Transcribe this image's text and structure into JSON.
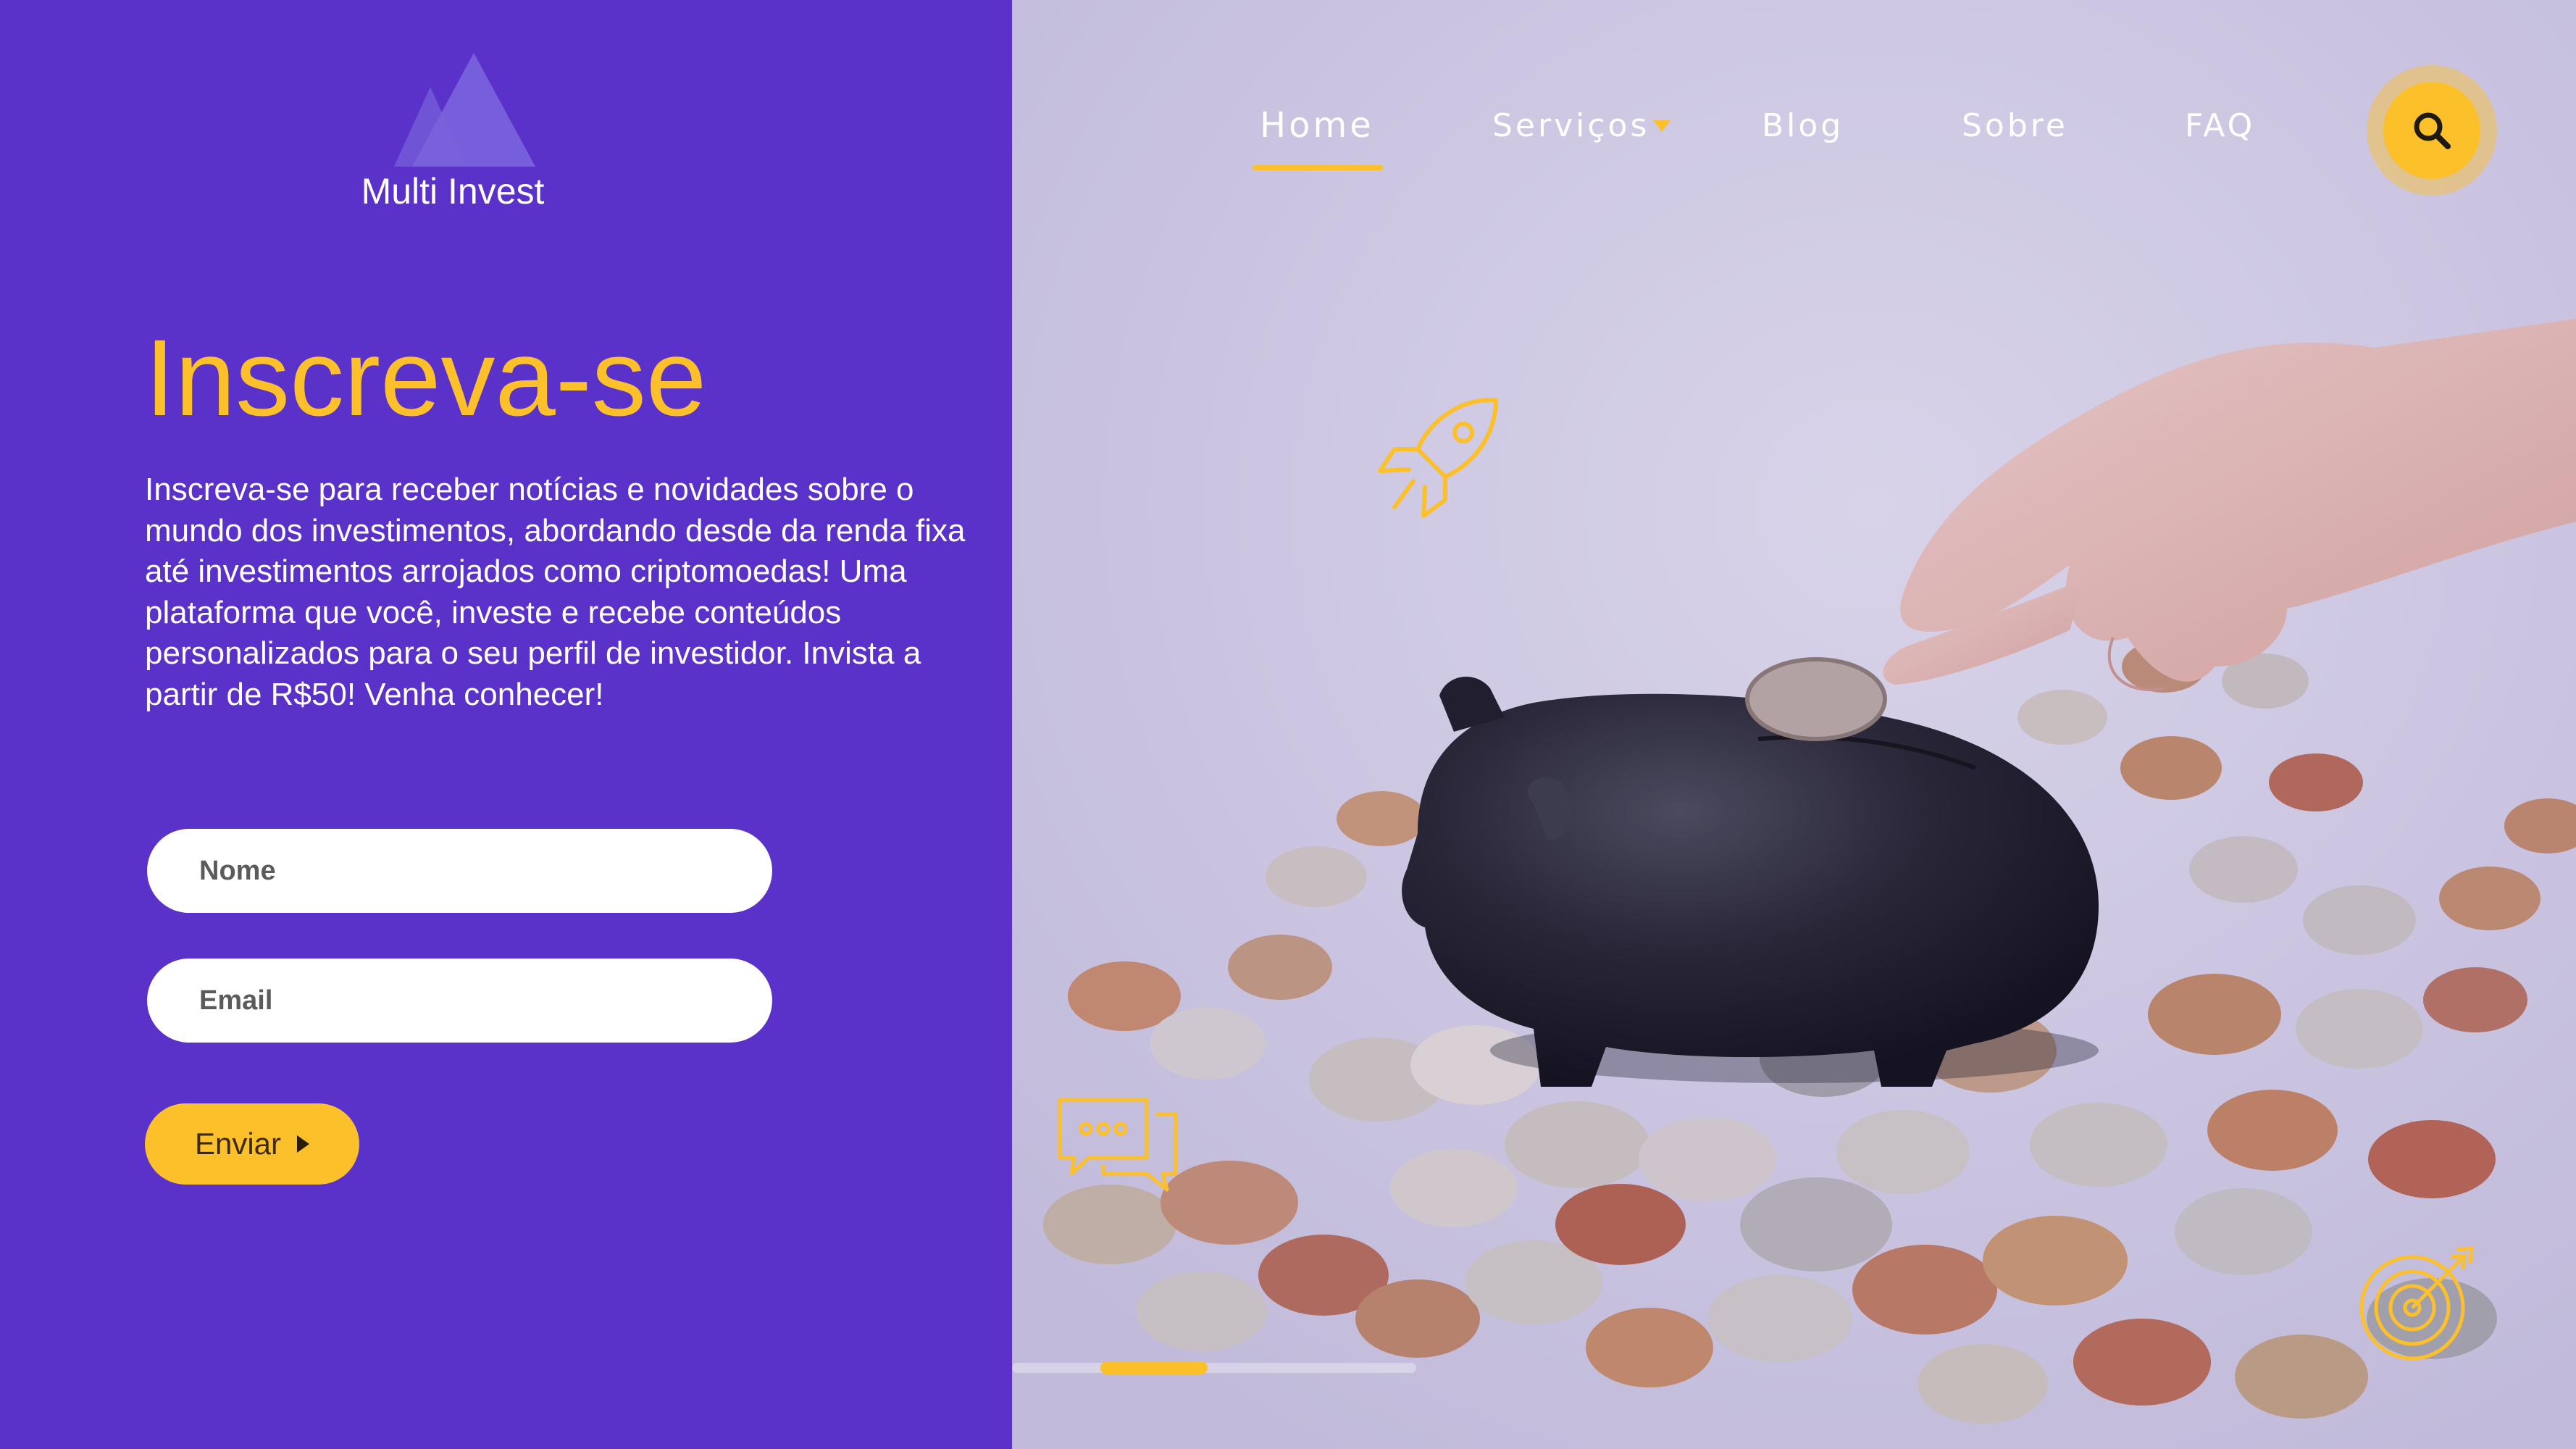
{
  "brand": {
    "name": "Multi Invest",
    "logo_icon": "mountain-logo-icon"
  },
  "hero": {
    "title": "Inscreva-se",
    "description": "Inscreva-se para receber notícias e novidades sobre o mundo dos  investimentos, abordando desde da renda fixa até investimentos arrojados como criptomoedas! Uma plataforma que você, investe e recebe conteúdos personalizados para o seu perfil de investidor.  Invista a partir de R$50! Venha conhecer!"
  },
  "form": {
    "name_placeholder": "Nome",
    "email_placeholder": "Email",
    "submit_label": "Enviar"
  },
  "nav": {
    "items": [
      {
        "label": "Home",
        "active": true
      },
      {
        "label": "Serviços",
        "has_dropdown": true
      },
      {
        "label": "Blog"
      },
      {
        "label": "Sobre"
      },
      {
        "label": "FAQ"
      }
    ],
    "search_icon": "search-icon"
  },
  "decor_icons": [
    "rocket-icon",
    "chat-bubbles-icon",
    "target-icon"
  ],
  "carousel": {
    "slide_count": 4,
    "active_slide": 2
  },
  "colors": {
    "panel": "#5a31c9",
    "accent": "#fcc02b",
    "text_light": "#ffffff"
  }
}
